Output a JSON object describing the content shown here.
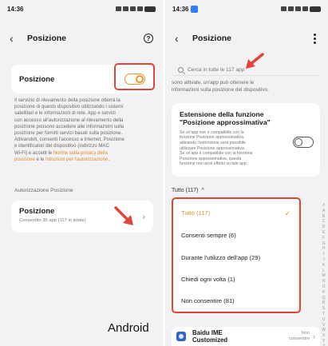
{
  "left": {
    "status_time": "14:36",
    "title": "Posizione",
    "toggle_label": "Posizione",
    "toggle_on": true,
    "desc_lines": [
      "Il servizio di rilevamento della posizione otterrà la",
      "posizione di questo dispositivo utilizzando i sistemi",
      "satellitari e le informazioni di rete. App e servizi",
      "con accesso all'autorizzazione al rilevamento della",
      "posizione possono accedere alle informazioni sulla",
      "posizione per fornirti servizi basati sulla posizione.",
      "Attivandoli, consenti l'accesso a Internet, Posizione",
      "e identificatori del dispositivo (indirizzo MAC"
    ],
    "desc_last_prefix": "Wi-Fi) e accetti le ",
    "desc_link1": "Norme sulla privacy della",
    "desc_link1_cont": "posizione",
    "desc_and": " e le ",
    "desc_link2": "Istruzioni per l'autorizzazione",
    "desc_end": ".",
    "section_label": "Autorizzazione Posizione",
    "perm_title": "Posizione",
    "perm_sub": "Consentito 35 app (117 in totale)",
    "caption": "Android"
  },
  "right": {
    "status_time": "14:36",
    "title": "Posizione",
    "search_placeholder": "Cerca in tutte le 117 app",
    "desc_lines": [
      "sono attivate, un'app può ottenere le",
      "informazioni sulla posizione del dispositivo."
    ],
    "ext_title_lines": [
      "Estensione della funzione",
      "\"Posizione approssimativa\""
    ],
    "ext_desc_lines": [
      "Se un'app non è compatibile con la",
      "funzione Posizione approssimativa,",
      "attivando l'estensione sarà possibile",
      "utilizzare Posizione approssimativa.",
      "Se un'app è compatibile con la funzione",
      "Posizione approssimativa, questa",
      "funzione non avrà effetto su tale app."
    ],
    "ext_toggle_on": false,
    "filter_label": "Tutto (117)",
    "dropdown": [
      {
        "label": "Tutto (117)",
        "selected": true
      },
      {
        "label": "Consenti sempre (6)",
        "selected": false
      },
      {
        "label": "Durante l'utilizzo dell'app (29)",
        "selected": false
      },
      {
        "label": "Chiedi ogni volta (1)",
        "selected": false
      },
      {
        "label": "Non consentire (81)",
        "selected": false
      }
    ],
    "alphabet": [
      "#",
      "A",
      "B",
      "C",
      "D",
      "E",
      "F",
      "G",
      "H",
      "I",
      "J",
      "K",
      "L",
      "M",
      "N",
      "O",
      "P",
      "Q",
      "R",
      "S",
      "T",
      "U",
      "V",
      "W",
      "X",
      "Y",
      "Z"
    ],
    "app": {
      "name_lines": [
        "Baidu IME",
        "Customized"
      ],
      "status_lines": [
        "Non",
        "consentire"
      ]
    }
  },
  "colors": {
    "accent": "#e8962b",
    "highlight": "#e2433a",
    "link": "#e08a2a"
  }
}
